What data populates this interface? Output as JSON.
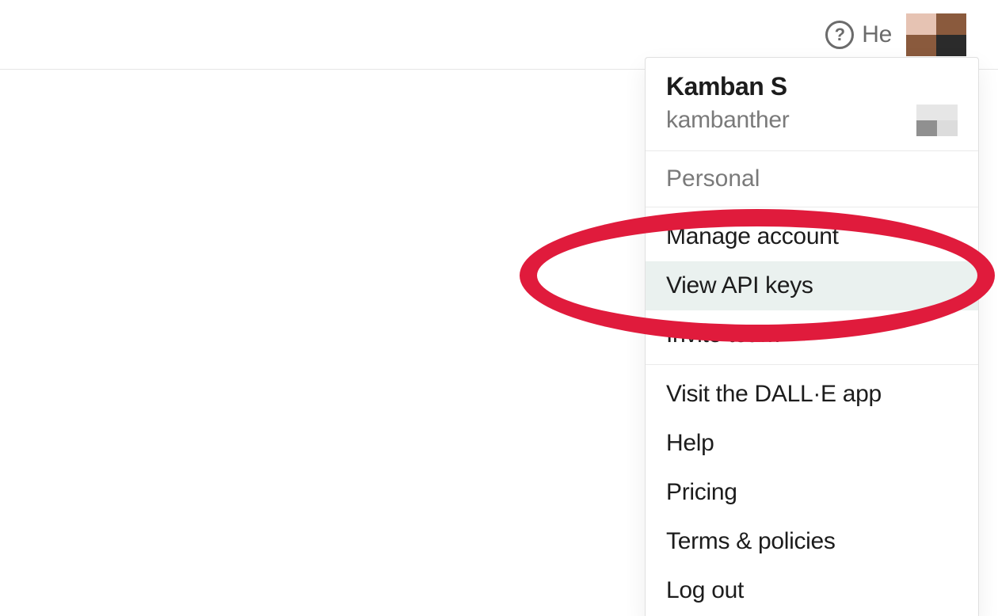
{
  "header": {
    "help_label": "He"
  },
  "dropdown": {
    "account": {
      "display_name": "Kamban S",
      "username": "kambanther"
    },
    "workspace_label": "Personal",
    "group_account": [
      {
        "label": "Manage account"
      },
      {
        "label": "View API keys",
        "highlight": true
      },
      {
        "label": "Invite team"
      }
    ],
    "group_links": [
      {
        "label": "Visit the DALL·E app"
      },
      {
        "label": "Help"
      },
      {
        "label": "Pricing"
      },
      {
        "label": "Terms & policies"
      },
      {
        "label": "Log out"
      }
    ]
  }
}
